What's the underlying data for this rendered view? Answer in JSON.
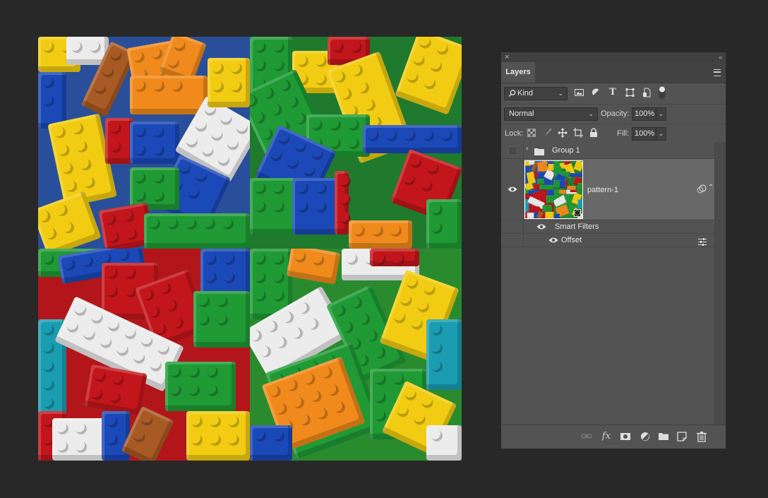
{
  "canvas": {
    "description": "tiled pattern preview of colorful toy building bricks, four offset quadrants",
    "colors": {
      "yellow": "#f2cc12",
      "red": "#c2161c",
      "blue": "#1b49b8",
      "green": "#1f9a35",
      "orange": "#f08a1c",
      "white": "#ececec",
      "teal": "#1a9db0",
      "brown": "#a85a24"
    }
  },
  "panel": {
    "close_glyph": "×",
    "collapse_glyph": "‹‹",
    "tab_label": "Layers",
    "filter": {
      "kind_label": "Kind",
      "filter_icons": [
        "image-filter-icon",
        "adjustment-filter-icon",
        "type-filter-icon",
        "shape-filter-icon",
        "smart-object-filter-icon",
        "filter-toggle-icon"
      ]
    },
    "blend_mode": "Normal",
    "opacity_label": "Opacity:",
    "opacity_value": "100%",
    "lock_label": "Lock:",
    "fill_label": "Fill:",
    "fill_value": "100%",
    "layers": [
      {
        "name": "Group 1",
        "type": "group",
        "visible": false
      },
      {
        "name": "pattern-1",
        "type": "smart-object",
        "visible": true,
        "selected": true
      },
      {
        "name": "Smart Filters",
        "type": "smart-filters",
        "visible": true
      },
      {
        "name": "Offset",
        "type": "filter",
        "visible": true
      }
    ],
    "footer_icons": [
      "link-layers-icon",
      "fx-icon",
      "add-mask-icon",
      "new-adjustment-icon",
      "new-group-icon",
      "new-layer-icon",
      "delete-layer-icon"
    ],
    "fx_label": "fx"
  }
}
